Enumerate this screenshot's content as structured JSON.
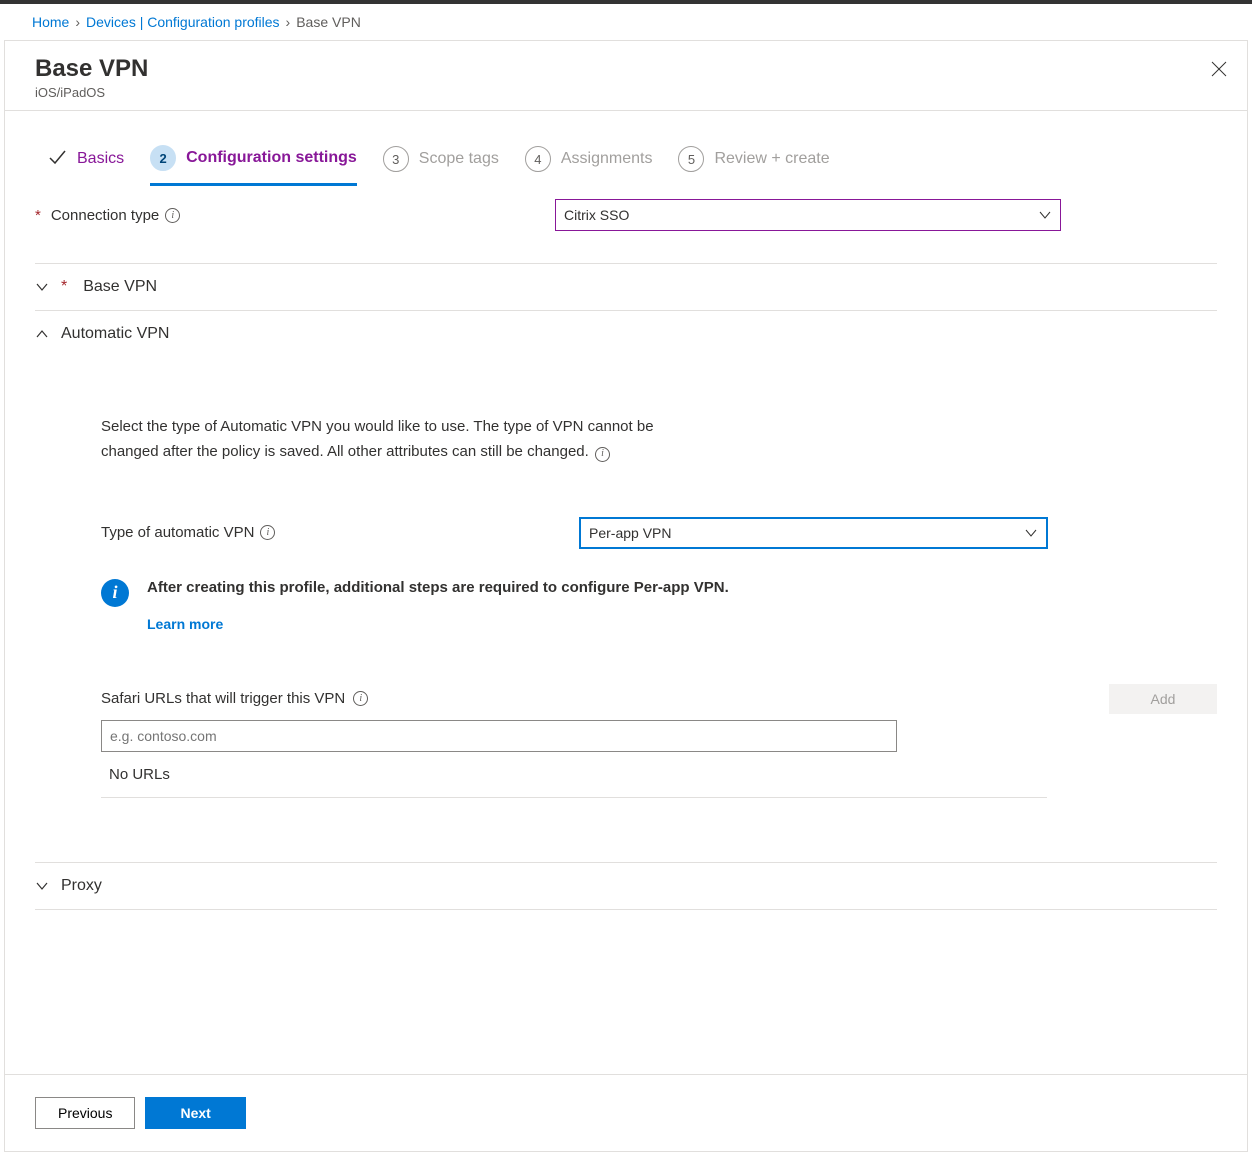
{
  "breadcrumb": {
    "home": "Home",
    "devices": "Devices | Configuration profiles",
    "current": "Base VPN"
  },
  "panel": {
    "title": "Base VPN",
    "subtitle": "iOS/iPadOS"
  },
  "wizard": {
    "step1": "Basics",
    "step2_num": "2",
    "step2": "Configuration settings",
    "step3_num": "3",
    "step3": "Scope tags",
    "step4_num": "4",
    "step4": "Assignments",
    "step5_num": "5",
    "step5": "Review + create"
  },
  "form": {
    "connection_type_label": "Connection type",
    "connection_type_value": "Citrix SSO",
    "base_vpn_section": "Base VPN",
    "auto_vpn_section": "Automatic VPN",
    "auto_vpn_desc": "Select the type of Automatic VPN you would like to use. The type of VPN cannot be changed after the policy is saved. All other attributes can still be changed.",
    "auto_vpn_type_label": "Type of automatic VPN",
    "auto_vpn_type_value": "Per-app VPN",
    "notice_text": "After creating this profile, additional steps are required to configure Per-app VPN.",
    "learn_more": "Learn more",
    "safari_label": "Safari URLs that will trigger this VPN",
    "add_button": "Add",
    "safari_placeholder": "e.g. contoso.com",
    "no_urls": "No URLs",
    "proxy_section": "Proxy"
  },
  "footer": {
    "previous": "Previous",
    "next": "Next"
  }
}
